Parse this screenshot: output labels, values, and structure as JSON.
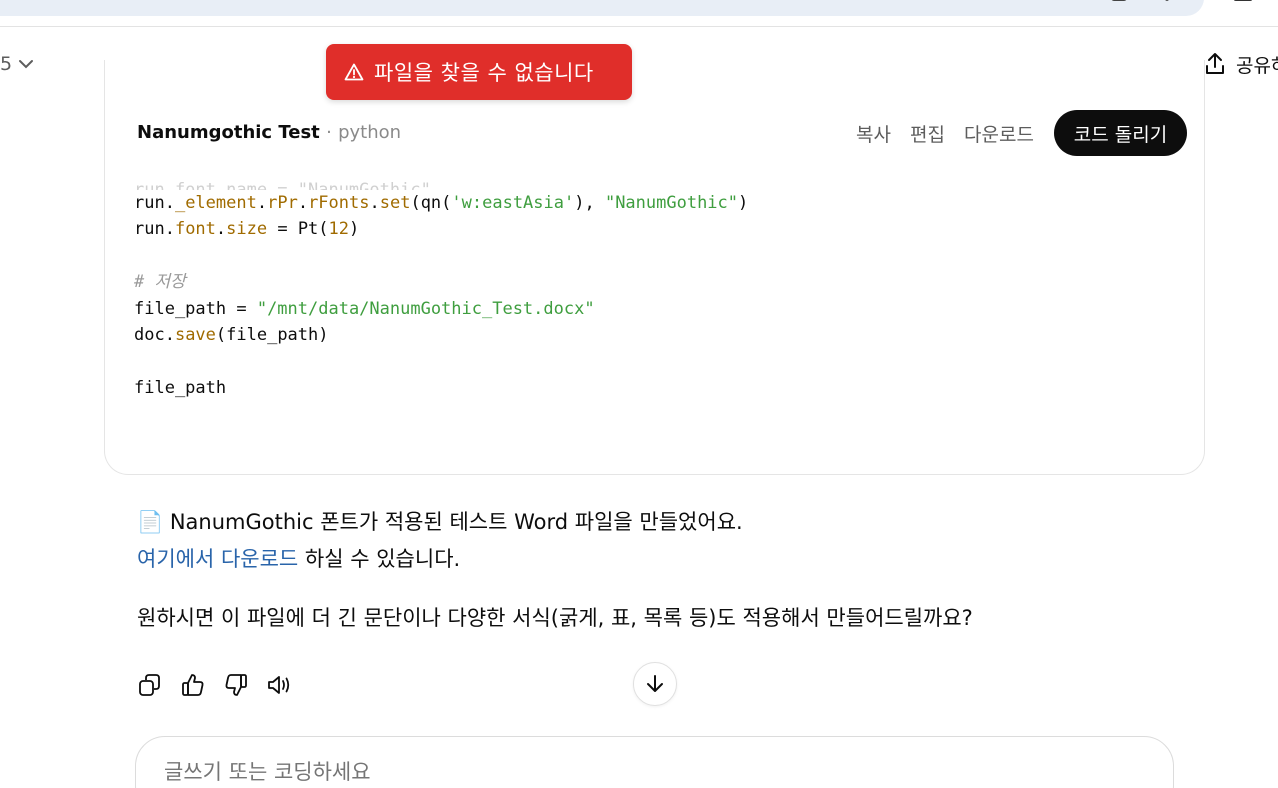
{
  "header": {
    "model_label": "5",
    "share_label": "공유하기"
  },
  "toast": {
    "message": "파일을 찾을 수 없습니다"
  },
  "code_block": {
    "title": "Nanumgothic Test",
    "separator": "·",
    "language": "python",
    "copy_label": "복사",
    "edit_label": "편집",
    "download_label": "다운로드",
    "run_label": "코드 돌리기",
    "partial_line": "run.font.name = \"NanumGothic\"",
    "lines": {
      "l1a": "run.",
      "l1b": "_element",
      "l1c": ".",
      "l1d": "rPr",
      "l1e": ".",
      "l1f": "rFonts",
      "l1g": ".",
      "l1h": "set",
      "l1i": "(qn(",
      "l1j": "'w:eastAsia'",
      "l1k": "), ",
      "l1l": "\"NanumGothic\"",
      "l1m": ")",
      "l2a": "run.",
      "l2b": "font",
      "l2c": ".",
      "l2d": "size",
      "l2e": " = Pt(",
      "l2f": "12",
      "l2g": ")",
      "comment": "# 저장",
      "l4a": "file_path = ",
      "l4b": "\"/mnt/data/NanumGothic_Test.docx\"",
      "l5a": "doc.",
      "l5b": "save",
      "l5c": "(file_path)",
      "l6": "file_path"
    }
  },
  "message": {
    "doc_emoji": "📄",
    "line1": "NanumGothic 폰트가 적용된 테스트 Word 파일을 만들었어요.",
    "link_text": "여기에서 다운로드",
    "line2_rest": " 하실 수 있습니다.",
    "line3": "원하시면 이 파일에 더 긴 문단이나 다양한 서식(굵게, 표, 목록 등)도 적용해서 만들어드릴까요?"
  },
  "composer": {
    "placeholder": "글쓰기 또는 코딩하세요"
  },
  "icons": [
    "search-icon",
    "tab-icon",
    "star-icon",
    "chevron-down-icon",
    "share-icon",
    "warning-icon",
    "copy-icon",
    "thumbs-up-icon",
    "thumbs-down-icon",
    "speaker-icon",
    "arrow-down-icon"
  ],
  "colors": {
    "toast_bg": "#e02e2a",
    "link": "#2964aa",
    "run_button_bg": "#0d0d0d",
    "code_keyword": "#a06b00",
    "code_string": "#3f9e3f",
    "code_comment": "#9a9a9a"
  }
}
